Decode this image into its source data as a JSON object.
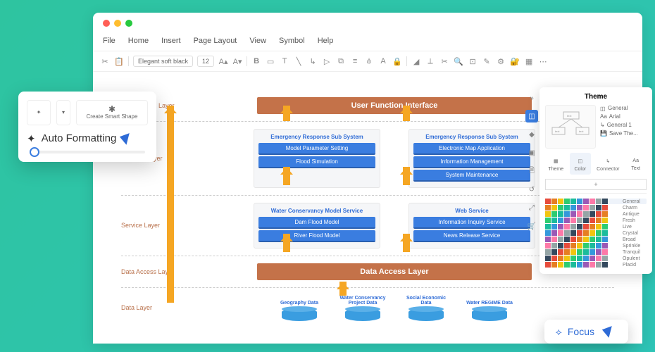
{
  "window": {
    "menus": [
      "File",
      "Home",
      "Insert",
      "Page Layout",
      "View",
      "Symbol",
      "Help"
    ],
    "font_family": "Elegant soft black",
    "font_size": "12"
  },
  "diagram": {
    "layers": [
      {
        "label": "Presentation Layer",
        "type": "banner",
        "title": "User Function Interface"
      },
      {
        "label": "Business layer",
        "type": "subs",
        "items": [
          {
            "title": "Emergency Response Sub System",
            "bars": [
              "Model Parameter Setting",
              "Flood Simulation"
            ]
          },
          {
            "title": "Emergency Response Sub System",
            "bars": [
              "Electronic Map Application",
              "Information Management",
              "System Maintenance"
            ]
          }
        ]
      },
      {
        "label": "Service Layer",
        "type": "subs",
        "items": [
          {
            "title": "Water Conservancy Model Service",
            "bars": [
              "Dam Flood Model",
              "River Flood Model"
            ]
          },
          {
            "title": "Web Service",
            "bars": [
              "Information Inquiry Service",
              "News Release Service"
            ]
          }
        ]
      },
      {
        "label": "Data Access Layer",
        "type": "banner",
        "title": "Data Access Layer"
      },
      {
        "label": "Data Layer",
        "type": "data",
        "dbs": [
          {
            "label": "Geography Data"
          },
          {
            "label": "Water Conservancy Project Data"
          },
          {
            "label": "Social Economic Data"
          },
          {
            "label": "Water REGIME Data"
          }
        ]
      }
    ]
  },
  "panel": {
    "title": "Theme",
    "opts": [
      "General",
      "Arial",
      "General 1",
      "Save The..."
    ],
    "tabs": [
      "Theme",
      "Color",
      "Connector",
      "Text"
    ],
    "active_tab": "Color",
    "swatch_sets": [
      "General",
      "Charm",
      "Antique",
      "Fresh",
      "Live",
      "Crystal",
      "Broad",
      "Sprinkle",
      "Tranquil",
      "Opulent",
      "Placid"
    ]
  },
  "popup": {
    "smart_shape": "Create Smart Shape",
    "auto_format": "Auto Formatting"
  },
  "focus_label": "Focus"
}
